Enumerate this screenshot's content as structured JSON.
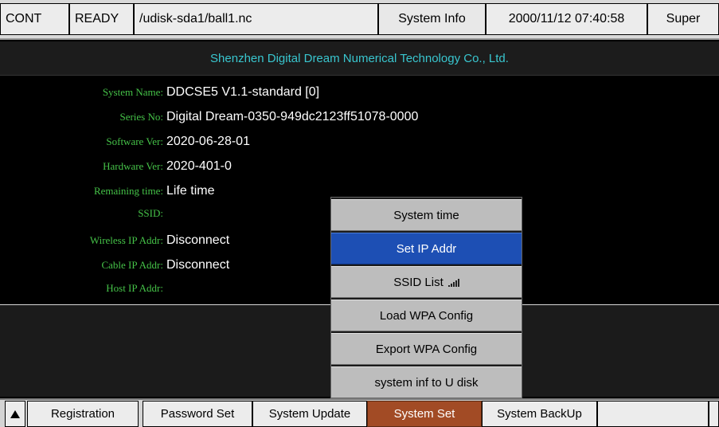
{
  "status_bar": {
    "mode": "CONT",
    "state": "READY",
    "file_path": "/udisk-sda1/ball1.nc",
    "page_name": "System Info",
    "datetime": "2000/11/12 07:40:58",
    "user_level": "Super"
  },
  "company": "Shenzhen Digital Dream Numerical Technology Co., Ltd.",
  "info": [
    {
      "label": "System Name:",
      "value": "DDCSE5 V1.1-standard [0]"
    },
    {
      "label": "Series No:",
      "value": "Digital Dream-0350-949dc2123ff51078-0000"
    },
    {
      "label": "Software Ver:",
      "value": "2020-06-28-01"
    },
    {
      "label": "Hardware Ver:",
      "value": "2020-401-0"
    },
    {
      "label": "Remaining time:",
      "value": "Life time"
    },
    {
      "label": "SSID:",
      "value": ""
    },
    {
      "label": "Wireless IP Addr:",
      "value": "Disconnect"
    },
    {
      "label": "Cable IP Addr:",
      "value": "Disconnect"
    },
    {
      "label": "Host IP Addr:",
      "value": ""
    }
  ],
  "popup_menu": {
    "items": [
      {
        "label": "System time",
        "active": false
      },
      {
        "label": "Set IP Addr",
        "active": true
      },
      {
        "label": "SSID List",
        "active": false,
        "icon": "signal-icon"
      },
      {
        "label": "Load WPA Config",
        "active": false
      },
      {
        "label": "Export WPA Config",
        "active": false
      },
      {
        "label": "system inf to U disk",
        "active": false
      }
    ]
  },
  "tabs": [
    {
      "label": "Registration",
      "active": false
    },
    {
      "label": "Password Set",
      "active": false
    },
    {
      "label": "System Update",
      "active": false
    },
    {
      "label": "System Set",
      "active": true
    },
    {
      "label": "System BackUp",
      "active": false
    },
    {
      "label": "",
      "active": false
    },
    {
      "label": "",
      "active": false
    }
  ],
  "colors": {
    "label_green": "#45c248",
    "company_cyan": "#39c6cf",
    "active_blue": "#1d4fb4",
    "active_tab": "#a24b25"
  }
}
